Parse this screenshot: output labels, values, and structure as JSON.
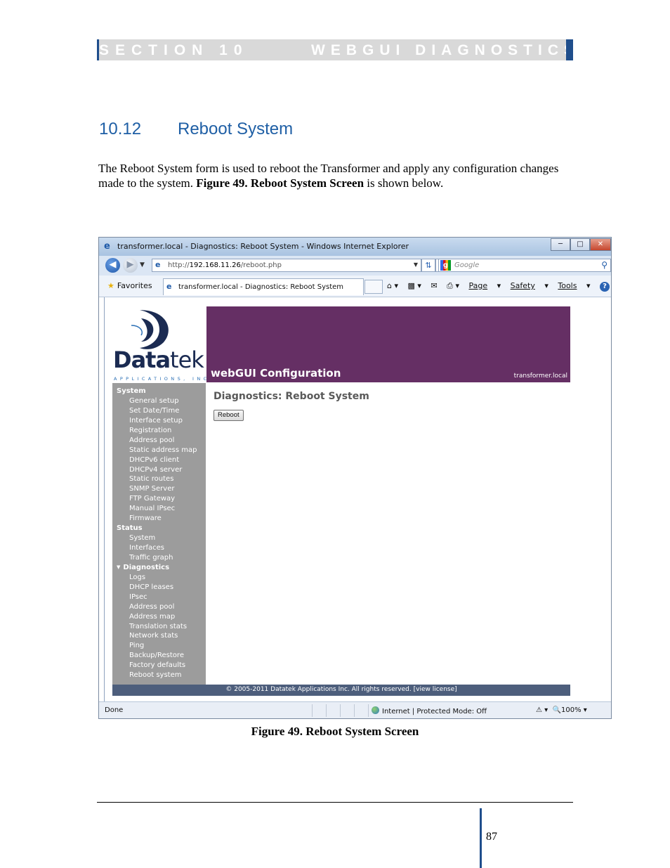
{
  "header": {
    "section": "SECTION 10",
    "title": "WEBGUI DIAGNOSTICS"
  },
  "heading": {
    "number": "10.12",
    "title": "Reboot System"
  },
  "body": {
    "text_before": "The Reboot System form is used to reboot the Transformer and apply any configuration changes made to the system.  ",
    "figure_ref": "Figure 49. Reboot System Screen",
    "text_after": " is shown below."
  },
  "browser": {
    "window_title": "transformer.local - Diagnostics: Reboot System - Windows Internet Explorer",
    "url_prefix": "http://",
    "url_host": "192.168.11.26",
    "url_path": "/reboot.php",
    "search_placeholder": "Google",
    "favorites_label": "Favorites",
    "tab_title": "transformer.local - Diagnostics: Reboot System",
    "commands": {
      "page": "Page",
      "safety": "Safety",
      "tools": "Tools"
    },
    "status_left": "Done",
    "status_zone": "Internet | Protected Mode: Off",
    "zoom": "100%"
  },
  "webgui": {
    "logo_data": "Data",
    "logo_tek": "tek",
    "logo_sub": "APPLICATIONS, INC",
    "banner_title": "webGUI Configuration",
    "hostname": "transformer.local",
    "page_title": "Diagnostics: Reboot System",
    "reboot_button": "Reboot",
    "footer": "© 2005-2011 Datatek Applications Inc. All rights reserved.  [view license]",
    "nav": [
      {
        "label": "System",
        "type": "group"
      },
      {
        "label": "General setup",
        "type": "item"
      },
      {
        "label": "Set Date/Time",
        "type": "item"
      },
      {
        "label": "Interface setup",
        "type": "item"
      },
      {
        "label": "Registration",
        "type": "item"
      },
      {
        "label": "Address pool",
        "type": "item"
      },
      {
        "label": "Static address map",
        "type": "item"
      },
      {
        "label": "DHCPv6 client",
        "type": "item"
      },
      {
        "label": "DHCPv4 server",
        "type": "item"
      },
      {
        "label": "Static routes",
        "type": "item"
      },
      {
        "label": "SNMP Server",
        "type": "item"
      },
      {
        "label": "FTP Gateway",
        "type": "item"
      },
      {
        "label": "Manual IPsec",
        "type": "item"
      },
      {
        "label": "Firmware",
        "type": "item"
      },
      {
        "label": "Status",
        "type": "group"
      },
      {
        "label": "System",
        "type": "item"
      },
      {
        "label": "Interfaces",
        "type": "item"
      },
      {
        "label": "Traffic graph",
        "type": "item"
      },
      {
        "label": "Diagnostics",
        "type": "group-open"
      },
      {
        "label": "Logs",
        "type": "item"
      },
      {
        "label": "DHCP leases",
        "type": "item"
      },
      {
        "label": "IPsec",
        "type": "item"
      },
      {
        "label": "Address pool",
        "type": "item"
      },
      {
        "label": "Address map",
        "type": "item"
      },
      {
        "label": "Translation stats",
        "type": "item"
      },
      {
        "label": "Network stats",
        "type": "item"
      },
      {
        "label": "Ping",
        "type": "item"
      },
      {
        "label": "Backup/Restore",
        "type": "item"
      },
      {
        "label": "Factory defaults",
        "type": "item"
      },
      {
        "label": "Reboot system",
        "type": "item"
      }
    ]
  },
  "caption": "Figure 49. Reboot System Screen",
  "page_number": "87"
}
